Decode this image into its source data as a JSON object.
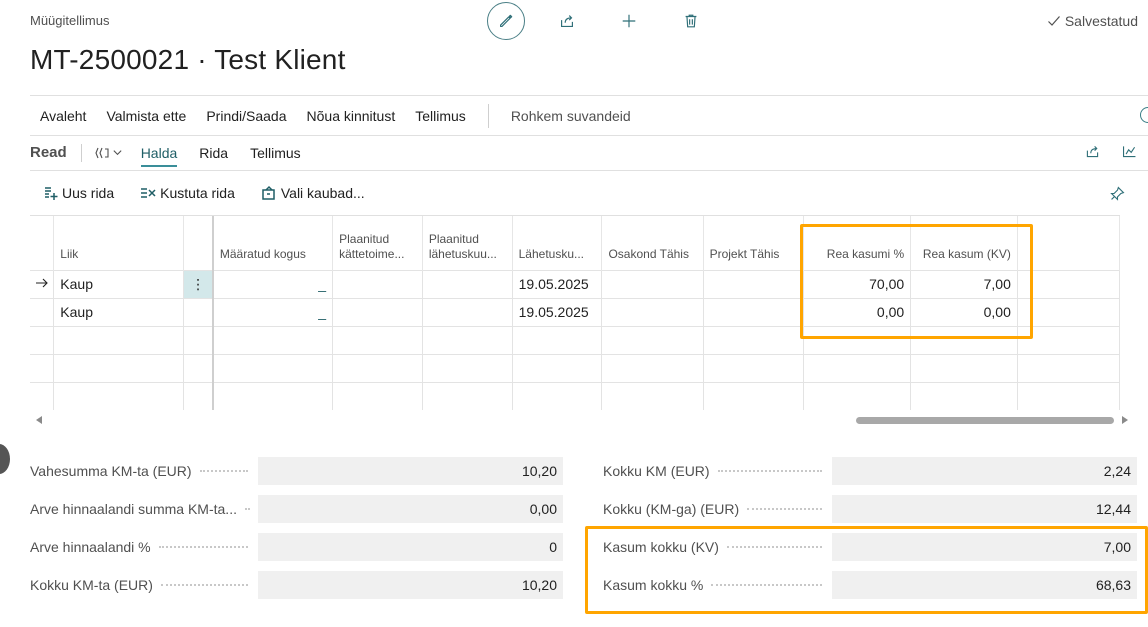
{
  "header": {
    "page_type": "Müügitellimus",
    "title": "MT-2500021 · Test Klient",
    "saved_label": "Salvestatud"
  },
  "icons": {
    "edit": "pencil-icon",
    "share": "share-icon",
    "new": "plus-icon",
    "delete": "trash-icon"
  },
  "action_bar": {
    "items": [
      "Avaleht",
      "Valmista ette",
      "Prindi/Saada",
      "Nõua kinnitust",
      "Tellimus"
    ],
    "more": "Rohkem suvandeid"
  },
  "lines": {
    "title": "Read",
    "tabs": [
      "Halda",
      "Rida",
      "Tellimus"
    ],
    "active_tab": "Halda",
    "commands": [
      "Uus rida",
      "Kustuta rida",
      "Vali kaubad..."
    ],
    "columns": [
      "Liik",
      "Määratud kogus",
      "Plaanitud kättetoime...",
      "Plaanitud lähetuskuu...",
      "Lähetusku...",
      "Osakond Tähis",
      "Projekt Tähis",
      "Rea kasumi %",
      "Rea kasum (KV)"
    ],
    "rows": [
      {
        "type": "Kaup",
        "qty": "_",
        "date": "19.05.2025",
        "profit_pct": "70,00",
        "profit_lcy": "7,00"
      },
      {
        "type": "Kaup",
        "qty": "_",
        "date": "19.05.2025",
        "profit_pct": "0,00",
        "profit_lcy": "0,00"
      }
    ]
  },
  "totals": {
    "left": [
      {
        "label": "Vahesumma KM-ta (EUR)",
        "value": "10,20"
      },
      {
        "label": "Arve hinnaalandi summa KM-ta...",
        "value": "0,00"
      },
      {
        "label": "Arve hinnaalandi %",
        "value": "0"
      },
      {
        "label": "Kokku KM-ta (EUR)",
        "value": "10,20"
      }
    ],
    "right": [
      {
        "label": "Kokku KM (EUR)",
        "value": "2,24"
      },
      {
        "label": "Kokku (KM-ga) (EUR)",
        "value": "12,44"
      },
      {
        "label": "Kasum kokku (KV)",
        "value": "7,00"
      },
      {
        "label": "Kasum kokku %",
        "value": "68,63"
      }
    ]
  },
  "colors": {
    "accent": "#3a8e99",
    "highlight": "#ffa500",
    "selected_cell": "#d3e8ea"
  }
}
